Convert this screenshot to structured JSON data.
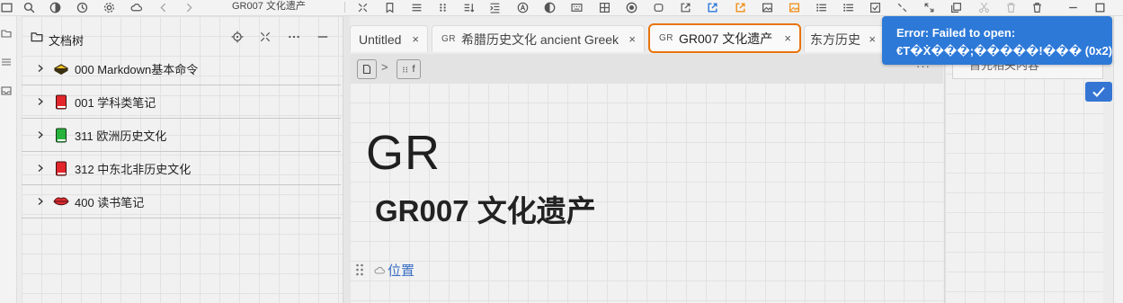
{
  "app": {
    "doc_title": "GR007 文化遗产",
    "toolbar_icons": [
      "square-icon",
      "search-icon",
      "contrast-icon",
      "history-icon",
      "gear-icon",
      "cloud-icon",
      "arrow-left-icon",
      "arrow-right-icon",
      "collapse-icon",
      "bookmark-icon",
      "align-icon",
      "drag-icon",
      "sort-icon",
      "indent-icon",
      "text-a-icon",
      "half-circle-icon",
      "keyboard-icon",
      "frame-icon",
      "record-icon",
      "refresh-icon",
      "external-link-icon",
      "export-blue-icon",
      "export-orange-icon",
      "image-icon",
      "image-orange-icon",
      "list-icon",
      "list-2-icon",
      "checkbox-icon",
      "shrink-icon",
      "expand-icon",
      "copy-icon",
      "scissors-icon",
      "trash-icon",
      "minimize-icon",
      "maximize-icon"
    ]
  },
  "filetree": {
    "title": "文档树",
    "items": [
      {
        "label": "000 Markdown基本命令",
        "icon": "yellow-notebook-icon"
      },
      {
        "label": "001 学科类笔记",
        "icon": "red-book-icon"
      },
      {
        "label": "311 欧洲历史文化",
        "icon": "green-book-icon"
      },
      {
        "label": "312 中东北非历史文化",
        "icon": "red-book-icon"
      },
      {
        "label": "400 读书笔记",
        "icon": "lips-icon"
      }
    ]
  },
  "tabs": [
    {
      "label": "Untitled",
      "icon": "",
      "active": false
    },
    {
      "label": "希腊历史文化 ancient Greek",
      "icon": "GR",
      "active": false
    },
    {
      "label": "GR007 文化遗产",
      "icon": "GR",
      "active": true
    },
    {
      "label": "东方历史",
      "icon": "",
      "active": false
    }
  ],
  "tab_close_glyph": "×",
  "breadcrumb": {
    "item": "f",
    "sep": ">",
    "more": "···"
  },
  "editor": {
    "heading": "GR",
    "title": "GR007 文化遗产",
    "location_link": "位置"
  },
  "right_panel": {
    "input_text": "首先相关内容"
  },
  "toast": {
    "line1": "Error: Failed to open:",
    "line2": "€T�Ẋ���;�����!��� (0x2)"
  },
  "colors": {
    "accent_tab": "#e8740c",
    "toast_bg": "#2d79d8",
    "link": "#3a6fc4"
  }
}
